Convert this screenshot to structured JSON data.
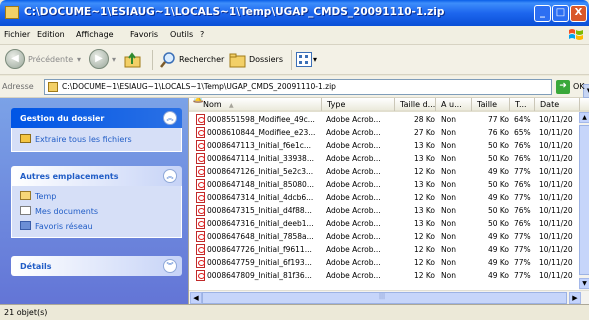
{
  "window": {
    "title": "C:\\DOCUME~1\\ESIAUG~1\\LOCALS~1\\Temp\\UGAP_CMDS_20091110-1.zip",
    "min_label": "_",
    "max_label": "□",
    "close_label": "X"
  },
  "menu": {
    "items": [
      "Fichier",
      "Edition",
      "Affichage",
      "Favoris",
      "Outils",
      "?"
    ]
  },
  "toolbar": {
    "back_label": "Précédente",
    "search_label": "Rechercher",
    "folders_label": "Dossiers"
  },
  "address": {
    "label": "Adresse",
    "value": "C:\\DOCUME~1\\ESIAUG~1\\LOCALS~1\\Temp\\UGAP_CMDS_20091110-1.zip",
    "go_label": "OK"
  },
  "taskpane": {
    "folder_tasks": {
      "title": "Gestion du dossier",
      "items": [
        "Extraire tous les fichiers"
      ]
    },
    "other_places": {
      "title": "Autres emplacements",
      "items": [
        "Temp",
        "Mes documents",
        "Favoris réseau"
      ]
    },
    "details": {
      "title": "Détails"
    }
  },
  "columns": [
    "Nom",
    "Type",
    "Taille d...",
    "A u...",
    "Taille",
    "T...",
    "Date"
  ],
  "files": [
    [
      "0008551598_Modifiee_49c...",
      "Adobe Acrob...",
      "28 Ko",
      "Non",
      "77 Ko",
      "64%",
      "10/11/20"
    ],
    [
      "0008610844_Modifiee_e23...",
      "Adobe Acrob...",
      "27 Ko",
      "Non",
      "76 Ko",
      "65%",
      "10/11/20"
    ],
    [
      "0008647113_Initial_f6e1c...",
      "Adobe Acrob...",
      "13 Ko",
      "Non",
      "50 Ko",
      "76%",
      "10/11/20"
    ],
    [
      "0008647114_Initial_33938...",
      "Adobe Acrob...",
      "13 Ko",
      "Non",
      "50 Ko",
      "76%",
      "10/11/20"
    ],
    [
      "0008647126_Initial_5e2c3...",
      "Adobe Acrob...",
      "12 Ko",
      "Non",
      "49 Ko",
      "77%",
      "10/11/20"
    ],
    [
      "0008647148_Initial_85080...",
      "Adobe Acrob...",
      "13 Ko",
      "Non",
      "50 Ko",
      "76%",
      "10/11/20"
    ],
    [
      "0008647314_Initial_4dcb6...",
      "Adobe Acrob...",
      "12 Ko",
      "Non",
      "49 Ko",
      "77%",
      "10/11/20"
    ],
    [
      "0008647315_Initial_d4f88...",
      "Adobe Acrob...",
      "13 Ko",
      "Non",
      "50 Ko",
      "76%",
      "10/11/20"
    ],
    [
      "0008647316_Initial_deeb1...",
      "Adobe Acrob...",
      "13 Ko",
      "Non",
      "50 Ko",
      "76%",
      "10/11/20"
    ],
    [
      "0008647648_Initial_7858a...",
      "Adobe Acrob...",
      "12 Ko",
      "Non",
      "49 Ko",
      "77%",
      "10/11/20"
    ],
    [
      "0008647726_Initial_f9611...",
      "Adobe Acrob...",
      "12 Ko",
      "Non",
      "49 Ko",
      "77%",
      "10/11/20"
    ],
    [
      "0008647759_Initial_6f193...",
      "Adobe Acrob...",
      "12 Ko",
      "Non",
      "49 Ko",
      "77%",
      "10/11/20"
    ],
    [
      "0008647809_Initial_81f36...",
      "Adobe Acrob...",
      "12 Ko",
      "Non",
      "49 Ko",
      "77%",
      "10/11/20"
    ]
  ],
  "status": {
    "count": "21 objet(s)"
  },
  "icons": {
    "app": "zip-folder-icon",
    "back": "back-arrow-icon",
    "forward": "forward-arrow-icon",
    "up": "folder-up-icon",
    "search": "search-icon",
    "folders": "folders-icon",
    "views": "views-icon",
    "go": "go-arrow-icon",
    "file": "pdf-file-icon"
  },
  "colors": {
    "titlebar": "#0a5ee8",
    "taskpane": "#7ba2e7",
    "link": "#215dc6",
    "close": "#d9582a"
  }
}
